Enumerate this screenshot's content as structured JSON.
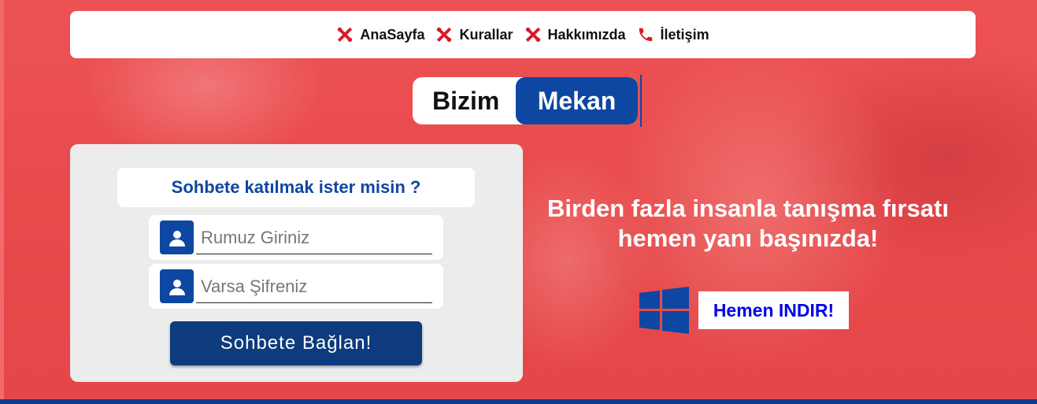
{
  "nav": {
    "items": [
      {
        "label": "AnaSayfa",
        "icon": "tools-icon"
      },
      {
        "label": "Kurallar",
        "icon": "tools-icon"
      },
      {
        "label": "Hakkımızda",
        "icon": "tools-icon"
      },
      {
        "label": "İletişim",
        "icon": "phone-icon"
      }
    ]
  },
  "logo": {
    "part1": "Bizim",
    "part2": "Mekan"
  },
  "login": {
    "title": "Sohbete katılmak ister misin ?",
    "nickname_placeholder": "Rumuz Giriniz",
    "password_placeholder": "Varsa Şifreniz",
    "connect_label": "Sohbete Bağlan!"
  },
  "promo": {
    "line1": "Birden fazla insanla tanışma fırsatı",
    "line2": "hemen yanı başınızda!"
  },
  "download": {
    "label": "Hemen INDIR!",
    "icon": "windows-icon"
  },
  "colors": {
    "accent": "#0d47a1",
    "nav_icon": "#d81b2a",
    "background": "#e8484a",
    "link": "#0000ee"
  }
}
